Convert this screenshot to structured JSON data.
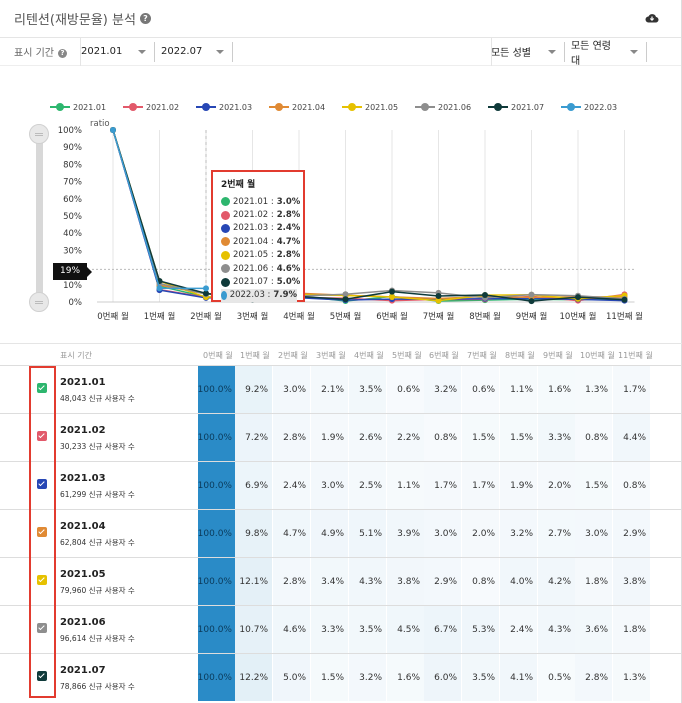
{
  "header": {
    "title": "리텐션(재방문율) 분석",
    "help": "?",
    "download_icon": "cloud-download-icon"
  },
  "filters": {
    "period_label": "표시 기간",
    "start": "2021.01",
    "end": "2022.07",
    "gender": "모든 성별",
    "age": "모든 연령대"
  },
  "colors": {
    "2021.01": "#2db66e",
    "2021.02": "#e2596a",
    "2021.03": "#2747b5",
    "2021.04": "#e08a34",
    "2021.05": "#e6c100",
    "2021.06": "#8e8e8e",
    "2021.07": "#0f3a3a",
    "2022.03": "#3a9bd0"
  },
  "chart_data": {
    "type": "line",
    "ylabel": "ratio",
    "ylim": [
      0,
      100
    ],
    "yticks": [
      "100%",
      "90%",
      "80%",
      "70%",
      "60%",
      "50%",
      "40%",
      "30%",
      "20%",
      "10%",
      "0%"
    ],
    "categories": [
      "0번째 월",
      "1번째 월",
      "2번째 월",
      "3번째 월",
      "4번째 월",
      "5번째 월",
      "6번째 월",
      "7번째 월",
      "8번째 월",
      "9번째 월",
      "10번째 월",
      "11번째 월"
    ],
    "series": [
      {
        "name": "2021.01",
        "values": [
          100,
          9.2,
          3.0,
          2.1,
          3.5,
          0.6,
          3.2,
          0.6,
          1.1,
          1.6,
          1.3,
          1.7
        ]
      },
      {
        "name": "2021.02",
        "values": [
          100,
          7.2,
          2.8,
          1.9,
          2.6,
          2.2,
          0.8,
          1.5,
          1.5,
          3.3,
          0.8,
          4.4
        ]
      },
      {
        "name": "2021.03",
        "values": [
          100,
          6.9,
          2.4,
          3.0,
          2.5,
          1.1,
          1.7,
          1.7,
          1.9,
          2.0,
          1.5,
          0.8
        ]
      },
      {
        "name": "2021.04",
        "values": [
          100,
          9.8,
          4.7,
          4.9,
          5.1,
          3.9,
          3.0,
          2.0,
          3.2,
          2.7,
          3.0,
          2.9
        ]
      },
      {
        "name": "2021.05",
        "values": [
          100,
          12.1,
          2.8,
          3.4,
          4.3,
          3.8,
          2.9,
          0.8,
          4.0,
          4.2,
          1.8,
          3.8
        ]
      },
      {
        "name": "2021.06",
        "values": [
          100,
          10.7,
          4.6,
          3.3,
          3.5,
          4.5,
          6.7,
          5.3,
          2.4,
          4.3,
          3.6,
          1.8
        ]
      },
      {
        "name": "2021.07",
        "values": [
          100,
          12.2,
          5.0,
          1.5,
          3.2,
          1.6,
          6.0,
          3.5,
          4.1,
          0.5,
          2.8,
          1.3
        ]
      },
      {
        "name": "2022.03",
        "values": [
          100,
          8.0,
          7.9
        ]
      }
    ],
    "threshold": {
      "value": 19,
      "label": "19%"
    },
    "legend_position": "top"
  },
  "tooltip": {
    "title": "2번째 월",
    "rows": [
      {
        "name": "2021.01",
        "value": "3.0%"
      },
      {
        "name": "2021.02",
        "value": "2.8%"
      },
      {
        "name": "2021.03",
        "value": "2.4%"
      },
      {
        "name": "2021.04",
        "value": "4.7%"
      },
      {
        "name": "2021.05",
        "value": "2.8%"
      },
      {
        "name": "2021.06",
        "value": "4.6%"
      },
      {
        "name": "2021.07",
        "value": "5.0%"
      },
      {
        "name": "2022.03",
        "value": "7.9%"
      }
    ]
  },
  "table": {
    "period_header": "표시 기간",
    "headers": [
      "0번째 월",
      "1번째 월",
      "2번째 월",
      "3번째 월",
      "4번째 월",
      "5번째 월",
      "6번째 월",
      "7번째 월",
      "8번째 월",
      "9번째 월",
      "10번째 월",
      "11번째 월"
    ],
    "rows": [
      {
        "name": "2021.01",
        "users": "48,043 신규 사용자 수",
        "cells": [
          "100.0%",
          "9.2%",
          "3.0%",
          "2.1%",
          "3.5%",
          "0.6%",
          "3.2%",
          "0.6%",
          "1.1%",
          "1.6%",
          "1.3%",
          "1.7%"
        ]
      },
      {
        "name": "2021.02",
        "users": "30,233 신규 사용자 수",
        "cells": [
          "100.0%",
          "7.2%",
          "2.8%",
          "1.9%",
          "2.6%",
          "2.2%",
          "0.8%",
          "1.5%",
          "1.5%",
          "3.3%",
          "0.8%",
          "4.4%"
        ]
      },
      {
        "name": "2021.03",
        "users": "61,299 신규 사용자 수",
        "cells": [
          "100.0%",
          "6.9%",
          "2.4%",
          "3.0%",
          "2.5%",
          "1.1%",
          "1.7%",
          "1.7%",
          "1.9%",
          "2.0%",
          "1.5%",
          "0.8%"
        ]
      },
      {
        "name": "2021.04",
        "users": "62,804 신규 사용자 수",
        "cells": [
          "100.0%",
          "9.8%",
          "4.7%",
          "4.9%",
          "5.1%",
          "3.9%",
          "3.0%",
          "2.0%",
          "3.2%",
          "2.7%",
          "3.0%",
          "2.9%"
        ]
      },
      {
        "name": "2021.05",
        "users": "79,960 신규 사용자 수",
        "cells": [
          "100.0%",
          "12.1%",
          "2.8%",
          "3.4%",
          "4.3%",
          "3.8%",
          "2.9%",
          "0.8%",
          "4.0%",
          "4.2%",
          "1.8%",
          "3.8%"
        ]
      },
      {
        "name": "2021.06",
        "users": "96,614 신규 사용자 수",
        "cells": [
          "100.0%",
          "10.7%",
          "4.6%",
          "3.3%",
          "3.5%",
          "4.5%",
          "6.7%",
          "5.3%",
          "2.4%",
          "4.3%",
          "3.6%",
          "1.8%"
        ]
      },
      {
        "name": "2021.07",
        "users": "78,866 신규 사용자 수",
        "cells": [
          "100.0%",
          "12.2%",
          "5.0%",
          "1.5%",
          "3.2%",
          "1.6%",
          "6.0%",
          "3.5%",
          "4.1%",
          "0.5%",
          "2.8%",
          "1.3%"
        ]
      }
    ]
  }
}
